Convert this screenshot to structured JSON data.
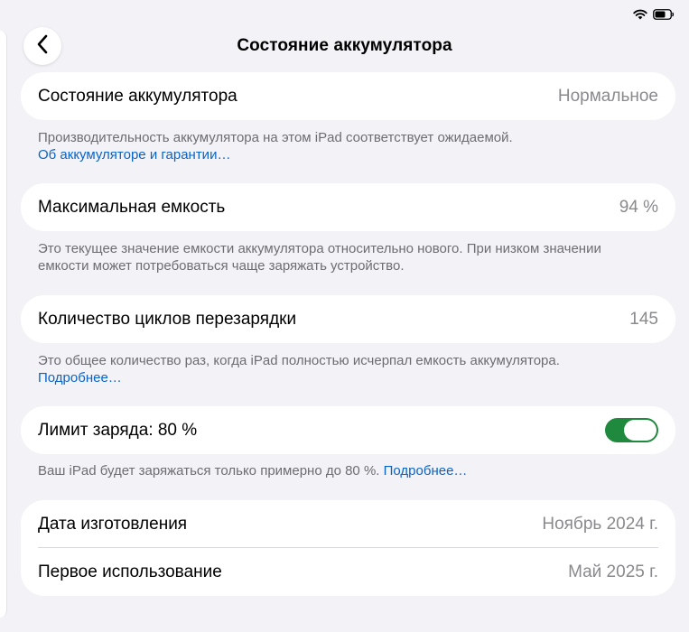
{
  "nav": {
    "title": "Состояние аккумулятора"
  },
  "health": {
    "label": "Состояние аккумулятора",
    "value": "Нормальное",
    "footnote": "Производительность аккумулятора на этом iPad соответствует ожидаемой.",
    "link": "Об аккумуляторе и гарантии…"
  },
  "capacity": {
    "label": "Максимальная емкость",
    "value": "94 %",
    "footnote_line1": "Это текущее значение емкости аккумулятора относительно нового. При низком значении",
    "footnote_line2": "емкости может потребоваться чаще заряжать устройство."
  },
  "cycles": {
    "label": "Количество циклов перезарядки",
    "value": "145",
    "footnote": "Это общее количество раз, когда iPad полностью исчерпал емкость аккумулятора.",
    "link": "Подробнее…"
  },
  "limit": {
    "label": "Лимит заряда: 80 %",
    "enabled": true,
    "footnote": "Ваш iPad будет заряжаться только примерно до 80 %. ",
    "link": "Подробнее…"
  },
  "dates": {
    "manufacture_label": "Дата изготовления",
    "manufacture_value": "Ноябрь 2024 г.",
    "first_use_label": "Первое использование",
    "first_use_value": "Май 2025 г."
  },
  "colors": {
    "background": "#f2f2f7",
    "link": "#0a64c8",
    "toggle_on": "#1f8a3e",
    "secondary_text": "#8a8a8e"
  }
}
